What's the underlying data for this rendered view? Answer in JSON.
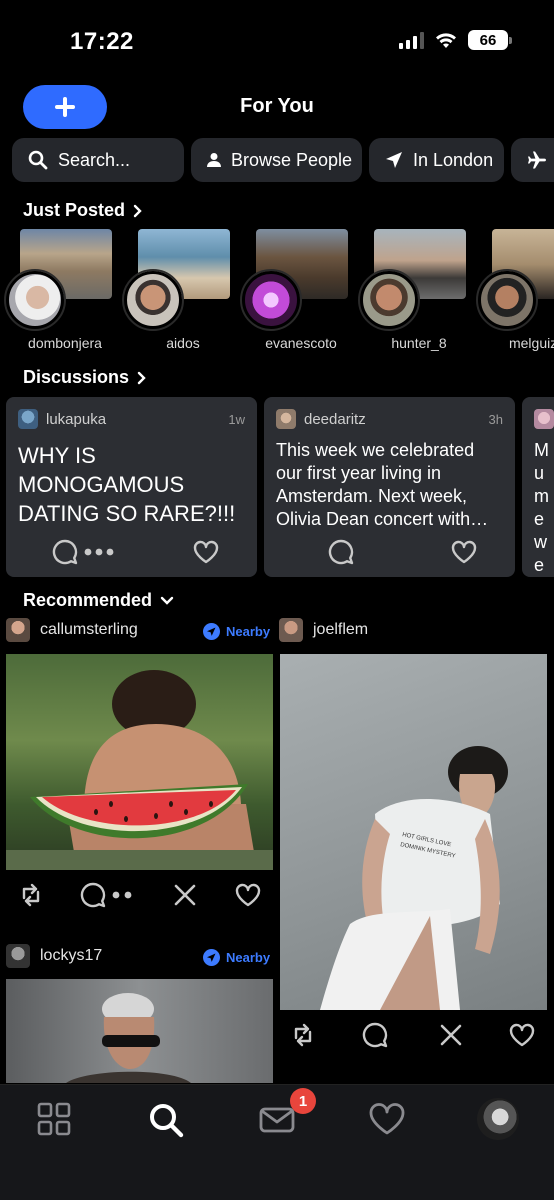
{
  "status_bar": {
    "time": "17:22",
    "battery": "66"
  },
  "header": {
    "title": "For You",
    "compose_icon": "plus-icon"
  },
  "chips": [
    {
      "label": "Search...",
      "icon": "search-icon"
    },
    {
      "label": "Browse People",
      "icon": "person-icon"
    },
    {
      "label": "In London",
      "icon": "location-arrow-icon"
    },
    {
      "label": "",
      "icon": "airplane-icon"
    }
  ],
  "just_posted": {
    "title": "Just Posted",
    "stories": [
      {
        "name": "dombonjera"
      },
      {
        "name": "aidos"
      },
      {
        "name": "evanescoto"
      },
      {
        "name": "hunter_8"
      },
      {
        "name": "melguizo"
      }
    ]
  },
  "discussions": {
    "title": "Discussions",
    "cards": [
      {
        "user": "lukapuka",
        "time": "1w",
        "text": "WHY IS MONOGAMOUS DATING SO RARE?!!!"
      },
      {
        "user": "deedaritz",
        "time": "3h",
        "text": "This week we celebrated our first year living in Amsterdam. Next week, Olivia Dean concert with…"
      },
      {
        "user": "",
        "time": "",
        "text": "Mu me we blu"
      }
    ]
  },
  "recommended": {
    "title": "Recommended",
    "posts": [
      {
        "user": "callumsterling",
        "nearby": "Nearby"
      },
      {
        "user": "joelflem",
        "nearby": ""
      },
      {
        "user": "lockys17",
        "nearby": "Nearby"
      }
    ]
  },
  "bottom_nav": {
    "items": [
      "grid-icon",
      "search-icon",
      "mail-icon",
      "heart-icon",
      "profile-avatar"
    ],
    "mail_badge": "1"
  },
  "colors": {
    "accent": "#2f6bff",
    "card": "#2c2e33",
    "chip": "#25272c",
    "badge": "#e8453c"
  }
}
